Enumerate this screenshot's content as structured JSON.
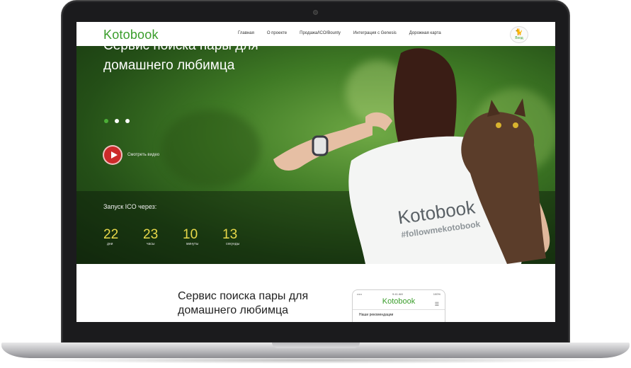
{
  "nav": {
    "logo": "Kotobook",
    "menu": [
      "Главная",
      "О проекте",
      "Продажа/ICO/Bounty",
      "Интеграция с Genesis",
      "Дорожная карта"
    ],
    "login_label": "Вход"
  },
  "hero": {
    "title": "Сервис поиска пары для домашнего любимца",
    "slides_total": 3,
    "active_slide": 1,
    "video_label": "Смотреть видео",
    "tshirt_logo": "Kotobook",
    "tshirt_hashtag": "#followmekotobook",
    "countdown_title": "Запуск ICO через:",
    "countdown": [
      {
        "value": "22",
        "caption": "дни"
      },
      {
        "value": "23",
        "caption": "часы"
      },
      {
        "value": "10",
        "caption": "минуты"
      },
      {
        "value": "13",
        "caption": "секунды"
      }
    ]
  },
  "section2": {
    "title": "Сервис поиска пары для домашнего любимца",
    "phone": {
      "time": "9:41 AM",
      "battery": "100%",
      "logo": "Kotobook",
      "section_title": "Наши рекомендации"
    }
  },
  "colors": {
    "brand_green": "#3a9d2b",
    "timer_yellow": "#e8d94a",
    "play_red": "#cc2a2a"
  }
}
